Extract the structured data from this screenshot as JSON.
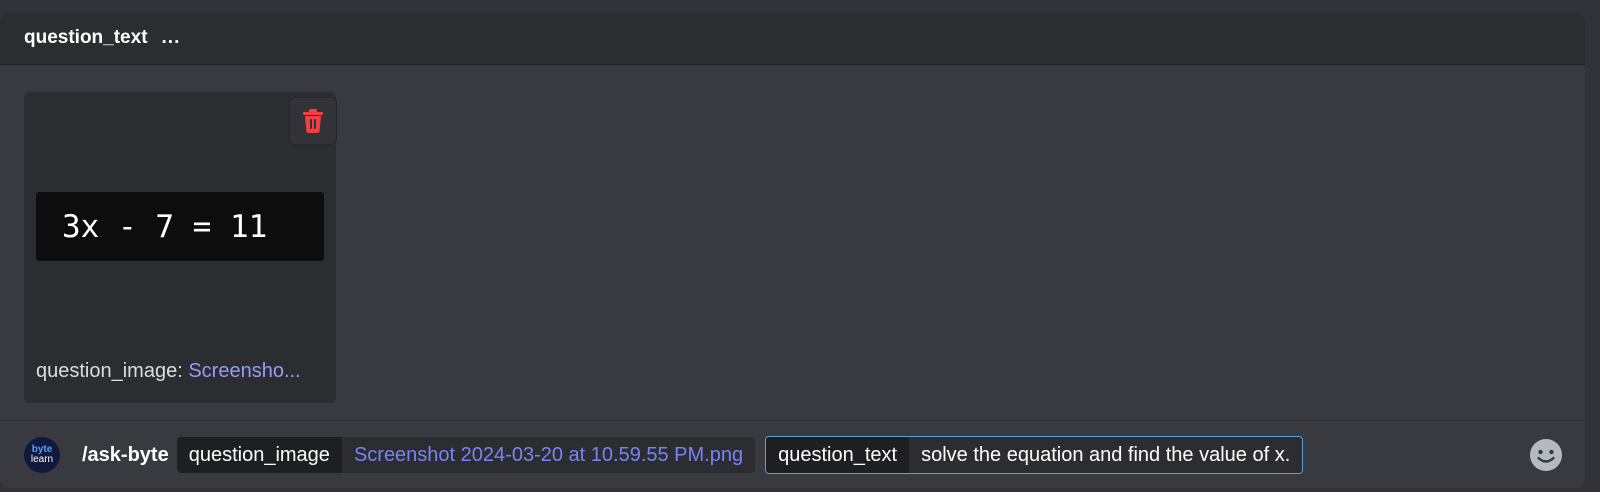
{
  "header": {
    "title": "question_text",
    "more": "..."
  },
  "attachment": {
    "preview_text": "3x - 7 = 11",
    "caption_label": "question_image: ",
    "caption_file": "Screensho...",
    "delete_icon": "trash-icon"
  },
  "command": {
    "avatar_line1": "byte",
    "avatar_line2": "learn",
    "name": "/ask-byte",
    "options": [
      {
        "label": "question_image",
        "value": "Screenshot 2024-03-20 at 10.59.55 PM.png"
      },
      {
        "label": "question_text",
        "value": "solve the equation and find the value of x."
      }
    ],
    "emoji_icon": "emoji-smile-icon"
  },
  "colors": {
    "background": "#313338",
    "panel": "#383a40",
    "delete_red": "#f23f43",
    "link": "#949cf7",
    "focus_border": "#5aa0d8"
  }
}
